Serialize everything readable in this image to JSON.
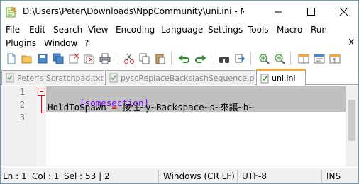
{
  "window": {
    "title": "D:\\Users\\Peter\\Downloads\\NppCommunity\\uni.ini - Notepad..."
  },
  "menu": {
    "row1": [
      "File",
      "Edit",
      "Search",
      "View",
      "Encoding",
      "Language",
      "Settings",
      "Tools",
      "Macro",
      "Run"
    ],
    "row2": [
      "Plugins",
      "Window",
      "?"
    ],
    "close_doc": "X"
  },
  "tabs": [
    {
      "label": "Peter's Scratchpad.txt",
      "active": false
    },
    {
      "label": "pyscReplaceBackslashSequence.py",
      "active": false
    },
    {
      "label": "uni.ini",
      "active": true
    }
  ],
  "editor": {
    "lines": [
      {
        "number": "1",
        "section": "[somesection]"
      },
      {
        "number": "2",
        "key": "HoldToSpawn",
        "op": "=",
        "value": "按住~y~Backspace~s~來讓~b~"
      },
      {
        "number": "3"
      }
    ]
  },
  "status": {
    "ln": "Ln : 1",
    "col": "Col : 1",
    "sel": "Sel : 53 | 2",
    "eol": "Windows (CR LF)",
    "encoding": "UTF-8",
    "mode": "INS"
  },
  "colors": {
    "section": "#8000ff",
    "operator": "#ff0000",
    "selection": "#c0c0c0",
    "active_tab_accent": "#f7a83a"
  }
}
